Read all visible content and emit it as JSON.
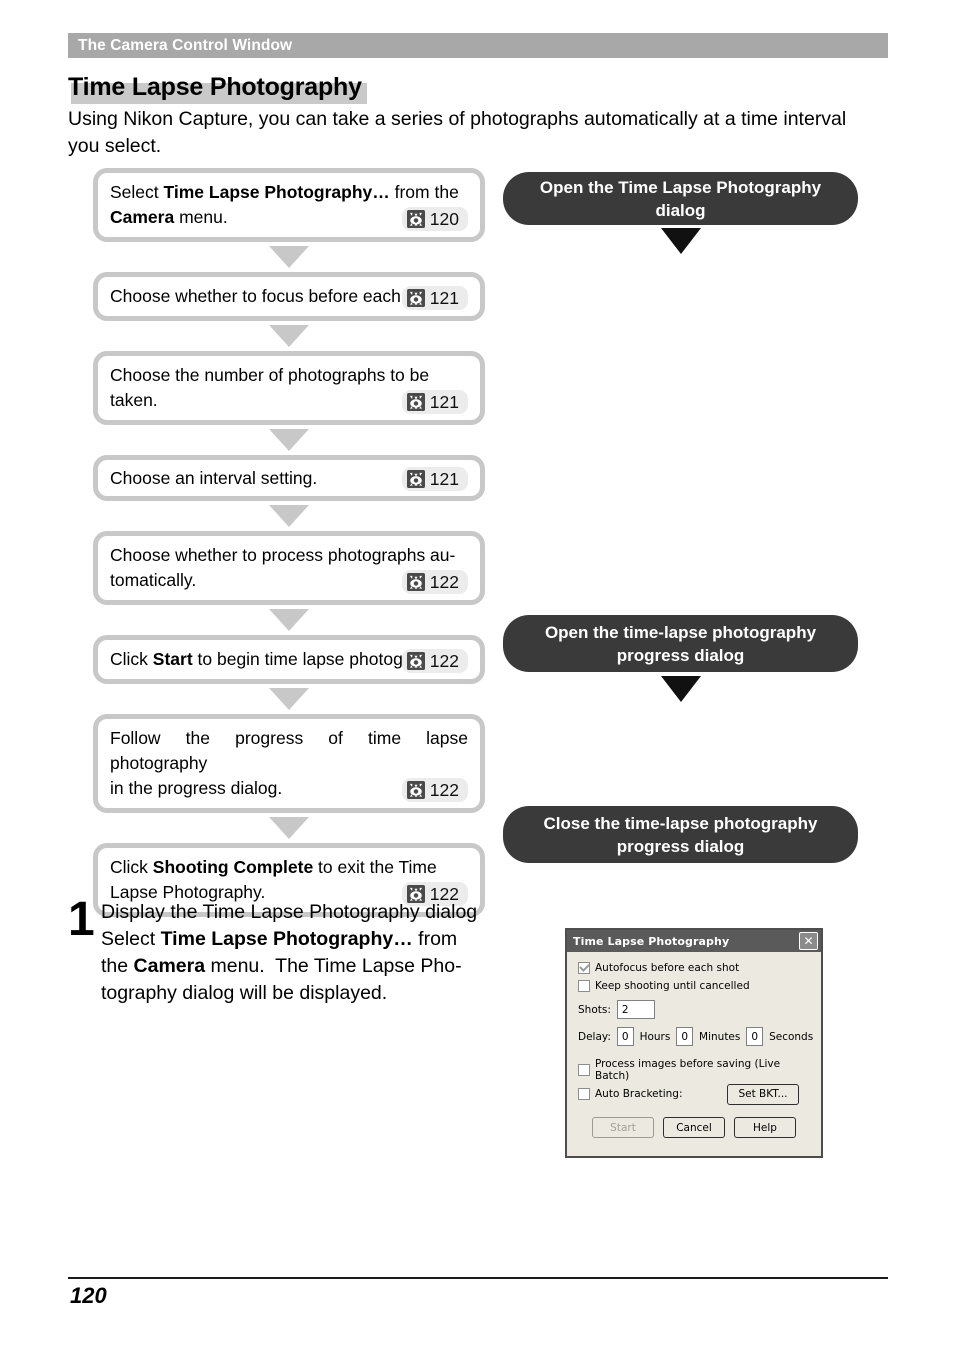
{
  "running_head": "The Camera Control Window",
  "section_title": "Time Lapse Photography",
  "intro": {
    "line1": "Using Nikon Capture, you can take a series of photographs automatically at a time interval",
    "line2": "you select."
  },
  "flow_steps": [
    {
      "lines": [
        "Select <b>Time Lapse Photography…</b> from the",
        "<b>Camera</b> menu."
      ],
      "page": "120",
      "icon": "page-reference-icon",
      "multiline": true
    },
    {
      "lines": [
        "Choose whether to focus before each shot."
      ],
      "page": "121",
      "icon": "page-reference-icon",
      "multiline": true
    },
    {
      "lines": [
        "Choose the number of photographs to be",
        "taken."
      ],
      "page": "121",
      "icon": "page-reference-icon",
      "multiline": true
    },
    {
      "lines": [
        "Choose an interval setting."
      ],
      "page": "121",
      "icon": "page-reference-icon",
      "multiline": false
    },
    {
      "lines": [
        "Choose whether to process photographs au-",
        "tomatically."
      ],
      "page": "122",
      "icon": "page-reference-icon",
      "multiline": true
    },
    {
      "lines": [
        "Click <b>Start</b> to begin time lapse photography."
      ],
      "page": "122",
      "icon": "page-reference-icon",
      "multiline": true
    },
    {
      "lines": [
        "Follow the progress of time lapse photography",
        "in the progress dialog."
      ],
      "page": "122",
      "icon": "page-reference-icon",
      "multiline": true
    },
    {
      "lines": [
        "Click <b>Shooting Complete</b> to exit the Time",
        "Lapse Photography."
      ],
      "page": "122",
      "icon": "page-reference-icon",
      "multiline": true
    }
  ],
  "callouts": [
    {
      "lines": [
        "Open the Time Lapse Photography dialog"
      ],
      "has_arrow": true
    },
    {
      "lines": [
        "Open the time-lapse photography",
        "progress dialog"
      ],
      "has_arrow": true
    },
    {
      "lines": [
        "Close the time-lapse photography",
        "progress dialog"
      ],
      "has_arrow": false
    }
  ],
  "step": {
    "number": "1",
    "heading": "Display the Time Lapse Photography dialog",
    "lines": [
      "Select <b>Time Lapse Photography…</b> from",
      "the <b>Camera</b> menu.&nbsp; The Time Lapse Pho-",
      "tography dialog will be displayed."
    ]
  },
  "dialog": {
    "title": "Time Lapse Photography",
    "close_label": "✕",
    "checkboxes": [
      {
        "label": "Autofocus before each shot",
        "checked": true
      },
      {
        "label": "Keep shooting until cancelled",
        "checked": false
      }
    ],
    "shots": {
      "label": "Shots:",
      "value": "2"
    },
    "delay": {
      "label": "Delay:",
      "hours": {
        "value": "0",
        "unit": "Hours"
      },
      "minutes": {
        "value": "0",
        "unit": "Minutes"
      },
      "seconds": {
        "value": "0",
        "unit": "Seconds"
      }
    },
    "process_images": {
      "label": "Process images before saving (Live Batch)",
      "checked": false
    },
    "auto_bracketing": {
      "label": "Auto Bracketing:",
      "checked": false
    },
    "set_bkt_button": "Set BKT...",
    "buttons": [
      {
        "label": "Start",
        "disabled": true
      },
      {
        "label": "Cancel",
        "disabled": false
      },
      {
        "label": "Help",
        "disabled": false
      }
    ]
  },
  "footer": {
    "page_number": "120"
  },
  "colors": {
    "running_head_bg": "#a8a8a8",
    "title_shadow": "#c9c9c9",
    "box_border": "#c8c8c8",
    "callout_bg": "#3a3a3a",
    "badge_bg": "#ececec",
    "arrow_black": "#111111",
    "dialog_bg": "#ece9e0",
    "dialog_title_bg": "#5a5a5a"
  }
}
